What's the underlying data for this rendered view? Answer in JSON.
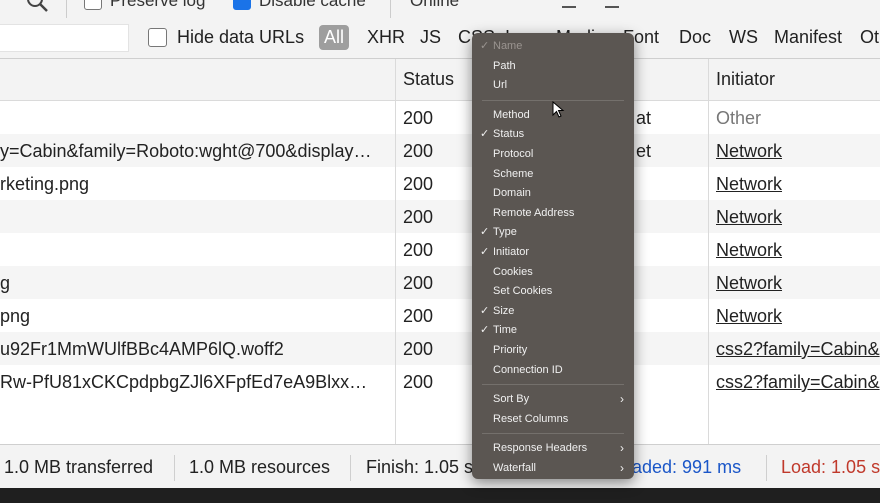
{
  "toolbar": {
    "preserve_log_label": "Preserve log",
    "disable_cache_label": "Disable cache",
    "throttle_label": "Online"
  },
  "filter_bar": {
    "hide_data_urls_label": "Hide data URLs",
    "types": [
      "All",
      "XHR",
      "JS",
      "CSS",
      "Img",
      "Media",
      "Font",
      "Doc",
      "WS",
      "Manifest",
      "Ot"
    ]
  },
  "table": {
    "headers": {
      "status": "Status",
      "initiator": "Initiator"
    },
    "rows": [
      {
        "name": "",
        "status": "200",
        "type": "at",
        "initiator": "Other"
      },
      {
        "name": "y=Cabin&family=Roboto:wght@700&display…",
        "status": "200",
        "type": "et",
        "initiator": "Network"
      },
      {
        "name": "rketing.png",
        "status": "200",
        "type": "",
        "initiator": "Network"
      },
      {
        "name": "",
        "status": "200",
        "type": "",
        "initiator": "Network"
      },
      {
        "name": "",
        "status": "200",
        "type": "",
        "initiator": "Network"
      },
      {
        "name": "g",
        "status": "200",
        "type": "",
        "initiator": "Network"
      },
      {
        "name": "png",
        "status": "200",
        "type": "",
        "initiator": "Network"
      },
      {
        "name": "u92Fr1MmWUlfBBc4AMP6lQ.woff2",
        "status": "200",
        "type": "",
        "initiator": "css2?family=Cabin&"
      },
      {
        "name": "Rw-PfU81xCKCpdpbgZJl6XFpfEd7eA9Blxx…",
        "status": "200",
        "type": "",
        "initiator": "css2?family=Cabin&"
      }
    ]
  },
  "status_bar": {
    "transferred": "1.0 MB transferred",
    "resources": "1.0 MB resources",
    "finish": "Finish: 1.05 s",
    "dom_loaded": "aded: 991 ms",
    "load": "Load: 1.05 s"
  },
  "context_menu": {
    "items": [
      {
        "label": "Name",
        "checked": true,
        "disabled": true
      },
      {
        "label": "Path",
        "checked": false
      },
      {
        "label": "Url",
        "checked": false
      },
      {
        "separator": true
      },
      {
        "label": "Method",
        "checked": false
      },
      {
        "label": "Status",
        "checked": true
      },
      {
        "label": "Protocol",
        "checked": false
      },
      {
        "label": "Scheme",
        "checked": false
      },
      {
        "label": "Domain",
        "checked": false
      },
      {
        "label": "Remote Address",
        "checked": false
      },
      {
        "label": "Type",
        "checked": true
      },
      {
        "label": "Initiator",
        "checked": true
      },
      {
        "label": "Cookies",
        "checked": false
      },
      {
        "label": "Set Cookies",
        "checked": false
      },
      {
        "label": "Size",
        "checked": true
      },
      {
        "label": "Time",
        "checked": true
      },
      {
        "label": "Priority",
        "checked": false
      },
      {
        "label": "Connection ID",
        "checked": false
      },
      {
        "separator": true
      },
      {
        "label": "Sort By",
        "checked": false,
        "submenu": true
      },
      {
        "label": "Reset Columns",
        "checked": false
      },
      {
        "separator": true
      },
      {
        "label": "Response Headers",
        "checked": false,
        "submenu": true
      },
      {
        "label": "Waterfall",
        "checked": false,
        "submenu": true
      }
    ]
  },
  "colors": {
    "accent": "#1a73e8",
    "dom_loaded": "#1a56c8",
    "load": "#c0392b",
    "menu_bg": "#5b5652"
  },
  "icons": {
    "check": "✓",
    "submenu_arrow": "›"
  }
}
